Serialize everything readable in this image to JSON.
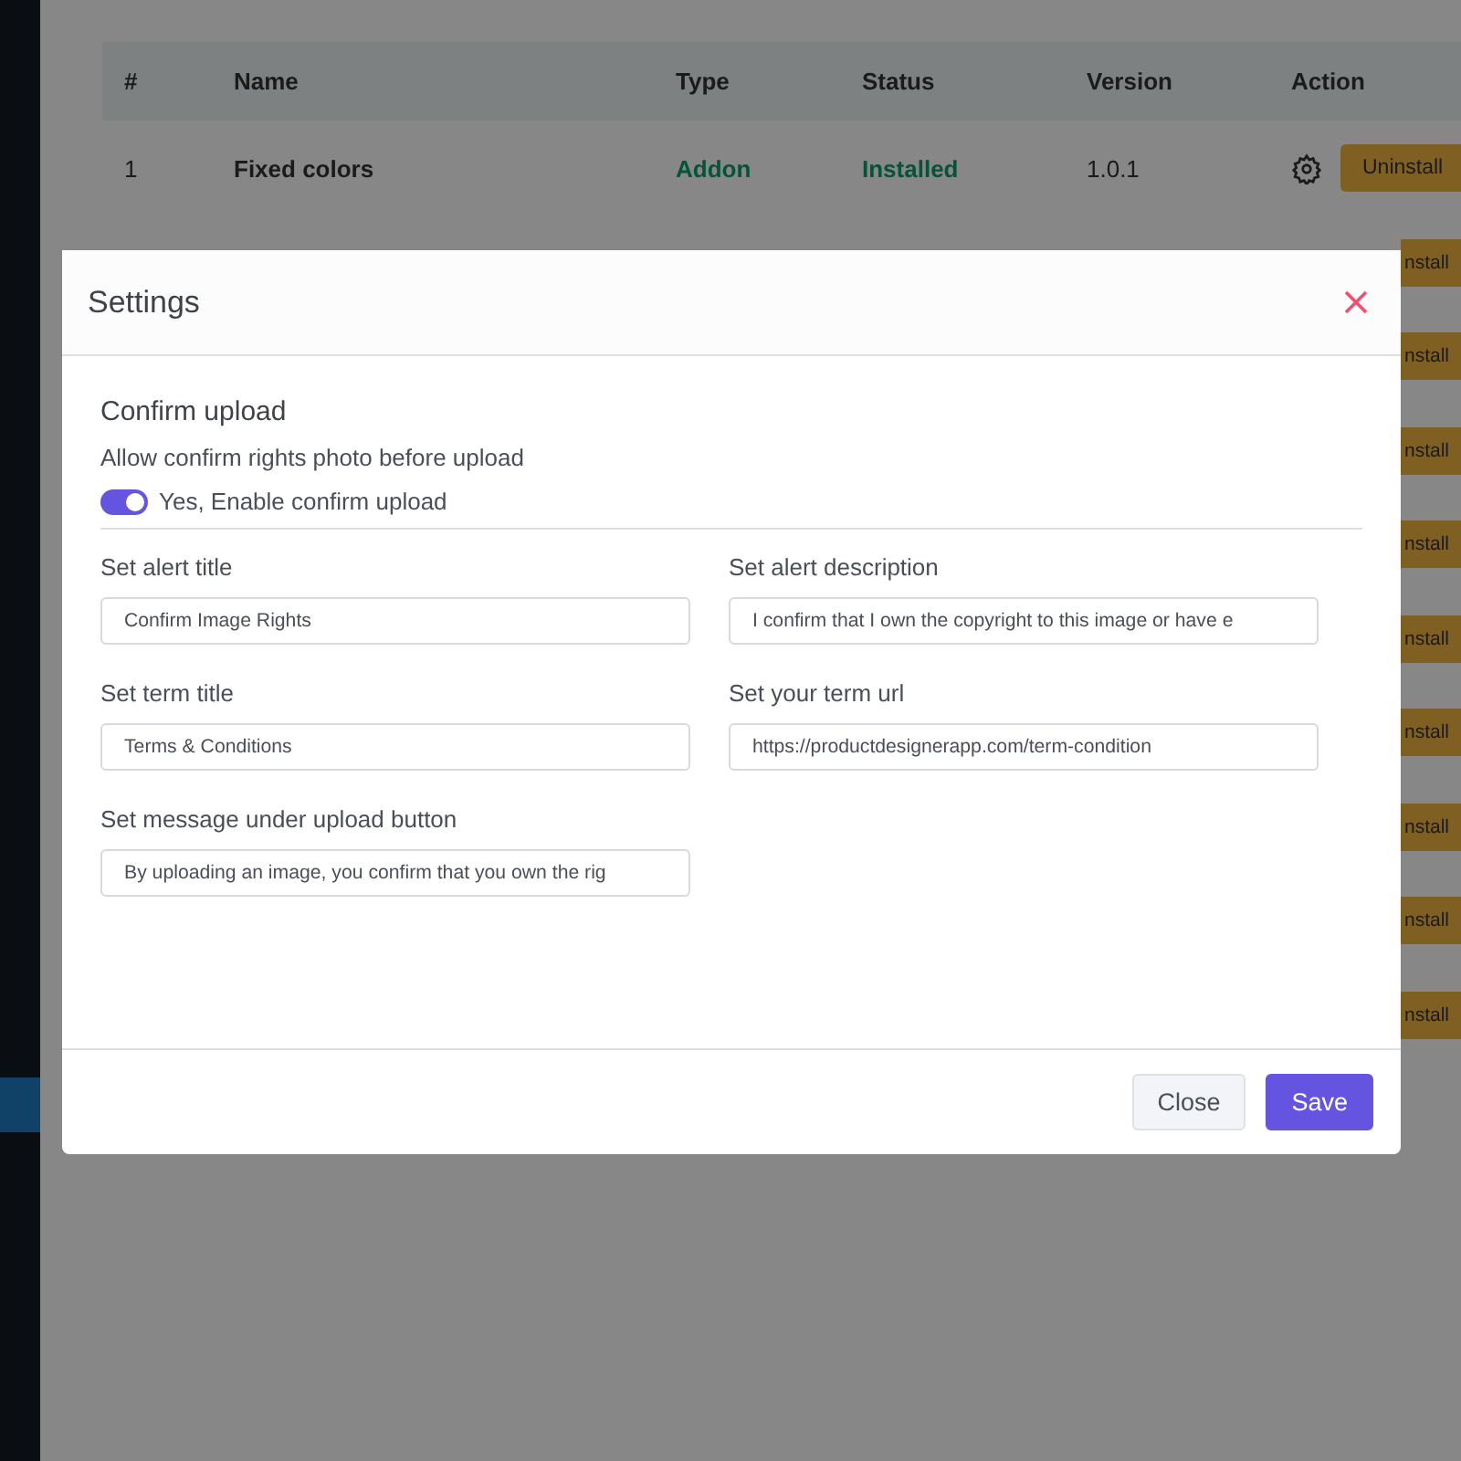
{
  "table": {
    "columns": [
      "#",
      "Name",
      "Type",
      "Status",
      "Version",
      "Action"
    ],
    "rows": [
      {
        "number": "1",
        "name": "Fixed colors",
        "type": "Addon",
        "status": "Installed",
        "version": "1.0.1",
        "action": "Uninstall"
      }
    ],
    "covered_row_actions": [
      "nstall",
      "nstall",
      "nstall",
      "nstall",
      "nstall",
      "nstall",
      "nstall",
      "nstall",
      "nstall"
    ]
  },
  "modal": {
    "title": "Settings",
    "section_title": "Confirm upload",
    "section_hint": "Allow confirm rights photo before upload",
    "toggle": {
      "label": "Yes, Enable confirm upload",
      "on": true
    },
    "fields": [
      {
        "label": "Set alert title",
        "value": "Confirm Image Rights"
      },
      {
        "label": "Set alert description",
        "value": "I confirm that I own the copyright to this image or have e"
      },
      {
        "label": "Set term title",
        "value": "Terms & Conditions"
      },
      {
        "label": "Set your term url",
        "value": "https://productdesignerapp.com/term-condition"
      },
      {
        "label": "Set message under upload button",
        "value": "By uploading an image, you confirm that you own the rig"
      }
    ],
    "buttons": [
      {
        "label": "Close",
        "kind": "secondary"
      },
      {
        "label": "Save",
        "kind": "primary"
      }
    ]
  }
}
